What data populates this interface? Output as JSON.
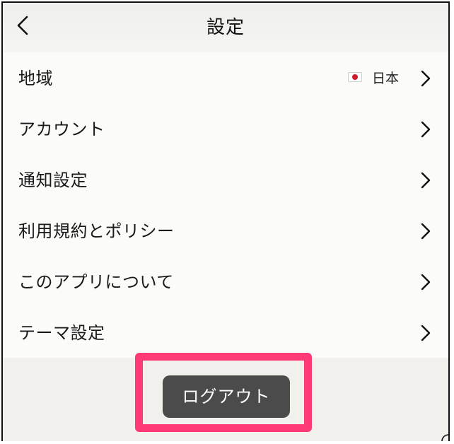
{
  "header": {
    "title": "設定",
    "back_icon": "chevron-left-icon"
  },
  "settings": {
    "items": [
      {
        "label": "地域",
        "value": "日本",
        "flag_icon": "japan-flag-icon"
      },
      {
        "label": "アカウント"
      },
      {
        "label": "通知設定"
      },
      {
        "label": "利用規約とポリシー"
      },
      {
        "label": "このアプリについて"
      },
      {
        "label": "テーマ設定"
      }
    ]
  },
  "footer": {
    "logout_label": "ログアウト"
  },
  "colors": {
    "highlight": "#ff3a77",
    "button_bg": "#4b4b4b",
    "flag_red": "#d11a2a"
  }
}
